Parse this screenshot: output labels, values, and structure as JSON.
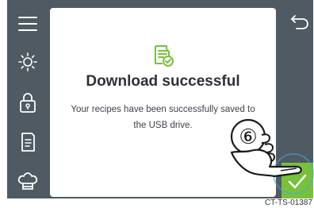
{
  "sidebar": {
    "items": [
      {
        "icon": "menu-icon"
      },
      {
        "icon": "brightness-icon"
      },
      {
        "icon": "lock-icon"
      },
      {
        "icon": "recipe-book-icon"
      },
      {
        "icon": "chef-hat-icon"
      }
    ]
  },
  "dialog": {
    "icon": "download-success-icon",
    "title": "Download successful",
    "message": "Your recipes have been successfully saved to the USB drive."
  },
  "header": {
    "back_icon": "back-arrow-icon"
  },
  "footer": {
    "confirm_icon": "checkmark-icon"
  },
  "annotation": {
    "step_number": "⑥"
  },
  "figure_code": "CT-TS-01387",
  "colors": {
    "background": "#4f5a62",
    "accent": "#78c13a",
    "title": "#2d3138"
  }
}
